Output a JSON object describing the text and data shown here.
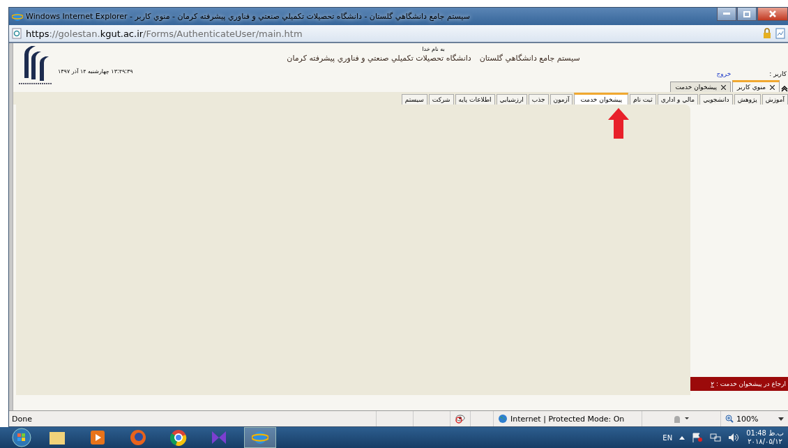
{
  "window": {
    "title": "سيستم جامع دانشگاهي گلستان - دانشگاه تحصيلات تكميلي صنعتي و فناوري پيشرفته كرمان - منوي كاربر - Windows Internet Explorer"
  },
  "address_bar": {
    "scheme": "https",
    "rest_before": "://golestan.",
    "domain": "kgut.ac.ir",
    "path": "/Forms/AuthenticateUser/main.htm"
  },
  "header": {
    "bismillah": "به نام خدا",
    "system_name": "سيستم جامع دانشگاهي گلستان",
    "university": "دانشگاه تحصيلات تكميلي صنعتي و فناوري پيشرفته كرمان",
    "datetime": "۱۳:۴۹:۳۹ چهارشنبه ۱۴ آذر ۱۳۹۷",
    "user_label": "كاربر :",
    "logout": "خروج"
  },
  "open_tabs": [
    {
      "label": "منوي كاربر",
      "selected": true
    },
    {
      "label": "پيشخوان خدمت",
      "selected": false
    }
  ],
  "menu_tabs": [
    {
      "label": "آموزش",
      "selected": false
    },
    {
      "label": "پژوهش",
      "selected": false
    },
    {
      "label": "دانشجويي",
      "selected": false
    },
    {
      "label": "مالي و اداري",
      "selected": false
    },
    {
      "label": "ثبت نام",
      "selected": false
    },
    {
      "label": "پيشخوان خدمت",
      "selected": true
    },
    {
      "label": "آزمون",
      "selected": false
    },
    {
      "label": "جذب",
      "selected": false
    },
    {
      "label": "ارزشيابي",
      "selected": false
    },
    {
      "label": "اطلاعات پايه",
      "selected": false
    },
    {
      "label": "شركت",
      "selected": false
    },
    {
      "label": "سيستم",
      "selected": false
    }
  ],
  "referral_bar": {
    "label": "ارجاع در پيشخوان خدمت :",
    "count": "۲"
  },
  "status_bar": {
    "text": "Done",
    "zone": "Internet | Protected Mode: On",
    "zoom": "100%"
  },
  "taskbar": {
    "language": "EN",
    "time": "01:48 ب.ظ",
    "date": "۲۰۱۸/۰۵/۱۲"
  }
}
